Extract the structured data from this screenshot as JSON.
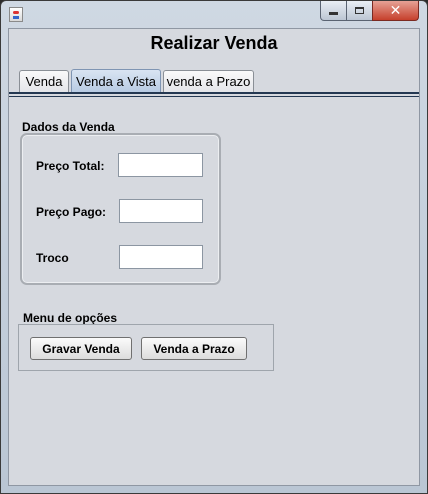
{
  "window": {
    "icon": "java-icon",
    "controls": {
      "minimize": "minimize-icon",
      "maximize": "maximize-icon",
      "close": "close-icon"
    }
  },
  "header": {
    "title": "Realizar Venda"
  },
  "tabs": [
    {
      "label": "Venda",
      "active": false
    },
    {
      "label": "Venda a Vista",
      "active": true
    },
    {
      "label": "venda a Prazo",
      "active": false
    }
  ],
  "dados_venda": {
    "label": "Dados da Venda",
    "fields": [
      {
        "label": "Preço Total:",
        "value": ""
      },
      {
        "label": "Preço Pago:",
        "value": ""
      },
      {
        "label": "Troco",
        "value": ""
      }
    ]
  },
  "menu_opcoes": {
    "label": "Menu de opções",
    "buttons": [
      {
        "label": "Gravar Venda"
      },
      {
        "label": "Venda a Prazo"
      }
    ]
  },
  "colors": {
    "active_tab": "#b8cbe3",
    "panel_background": "#d6d9df",
    "close_button": "#c6402c",
    "tab_rule": "#243852"
  }
}
